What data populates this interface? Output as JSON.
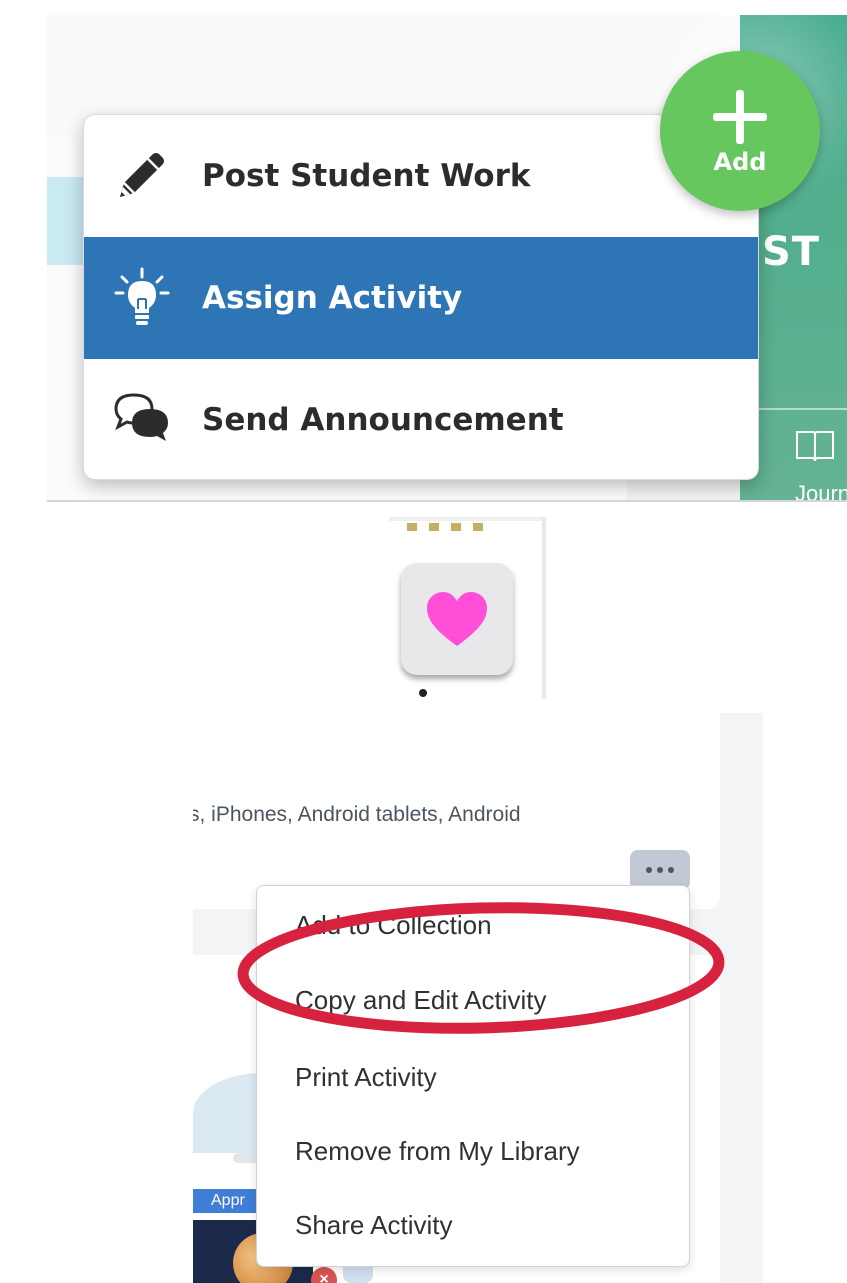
{
  "add_menu": {
    "fab_label": "Add",
    "items": [
      {
        "label": "Post Student Work",
        "icon": "pencil-icon"
      },
      {
        "label": "Assign Activity",
        "icon": "lightbulb-icon",
        "selected": true
      },
      {
        "label": "Send Announcement",
        "icon": "chat-bubbles-icon"
      }
    ],
    "partial_header_text": "ST",
    "partial_tab_label": "Journ",
    "colors": {
      "fab": "#67c75f",
      "selected": "#2e75b6",
      "side_panel": "#52ae8d"
    }
  },
  "heart_panel": {
    "icon": "heart-icon",
    "heart_color": "#ff4fd8"
  },
  "activity_menu": {
    "platforms_text": "s, iPhones, Android tablets, Android",
    "more_button_icon": "ellipsis-icon",
    "items": [
      {
        "label": "Add to Collection"
      },
      {
        "label": "Copy and Edit Activity",
        "highlighted": true
      },
      {
        "label": "Print Activity"
      },
      {
        "label": "Remove from My Library"
      },
      {
        "label": "Share Activity"
      }
    ],
    "badge": "Appr",
    "highlight_color": "#d7223f"
  }
}
